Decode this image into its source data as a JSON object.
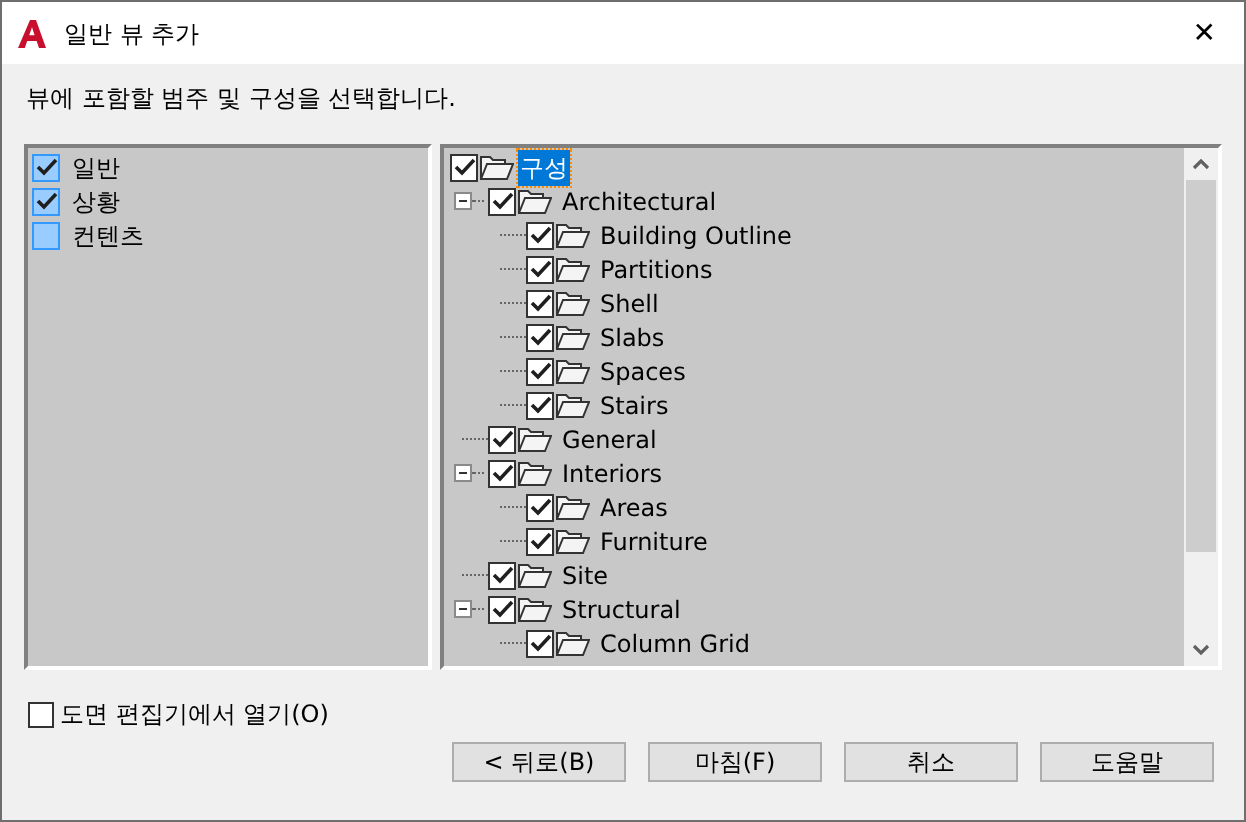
{
  "window": {
    "title": "일반 뷰 추가",
    "close": "✕"
  },
  "instruction": "뷰에 포함할 범주 및 구성을 선택합니다.",
  "categories": [
    {
      "label": "일반",
      "checked": true
    },
    {
      "label": "상황",
      "checked": true
    },
    {
      "label": "컨텐츠",
      "checked": false
    }
  ],
  "tree": [
    {
      "label": "구성",
      "checked": true,
      "selected": true,
      "expanded": true,
      "children": [
        {
          "label": "Architectural",
          "checked": true,
          "selected": false,
          "expanded": true,
          "children": [
            {
              "label": "Building Outline",
              "checked": true,
              "selected": false
            },
            {
              "label": "Partitions",
              "checked": true,
              "selected": false
            },
            {
              "label": "Shell",
              "checked": true,
              "selected": false
            },
            {
              "label": "Slabs",
              "checked": true,
              "selected": false
            },
            {
              "label": "Spaces",
              "checked": true,
              "selected": false
            },
            {
              "label": "Stairs",
              "checked": true,
              "selected": false
            }
          ]
        },
        {
          "label": "General",
          "checked": true,
          "selected": false
        },
        {
          "label": "Interiors",
          "checked": true,
          "selected": false,
          "expanded": true,
          "children": [
            {
              "label": "Areas",
              "checked": true,
              "selected": false
            },
            {
              "label": "Furniture",
              "checked": true,
              "selected": false
            }
          ]
        },
        {
          "label": "Site",
          "checked": true,
          "selected": false
        },
        {
          "label": "Structural",
          "checked": true,
          "selected": false,
          "expanded": true,
          "children": [
            {
              "label": "Column Grid",
              "checked": true,
              "selected": false
            }
          ]
        }
      ]
    }
  ],
  "open_in_editor": {
    "label": "도면 편집기에서 열기(O)",
    "checked": false
  },
  "buttons": [
    {
      "label": "< 뒤로(B)"
    },
    {
      "label": "마침(F)"
    },
    {
      "label": "취소"
    },
    {
      "label": "도움말"
    }
  ]
}
